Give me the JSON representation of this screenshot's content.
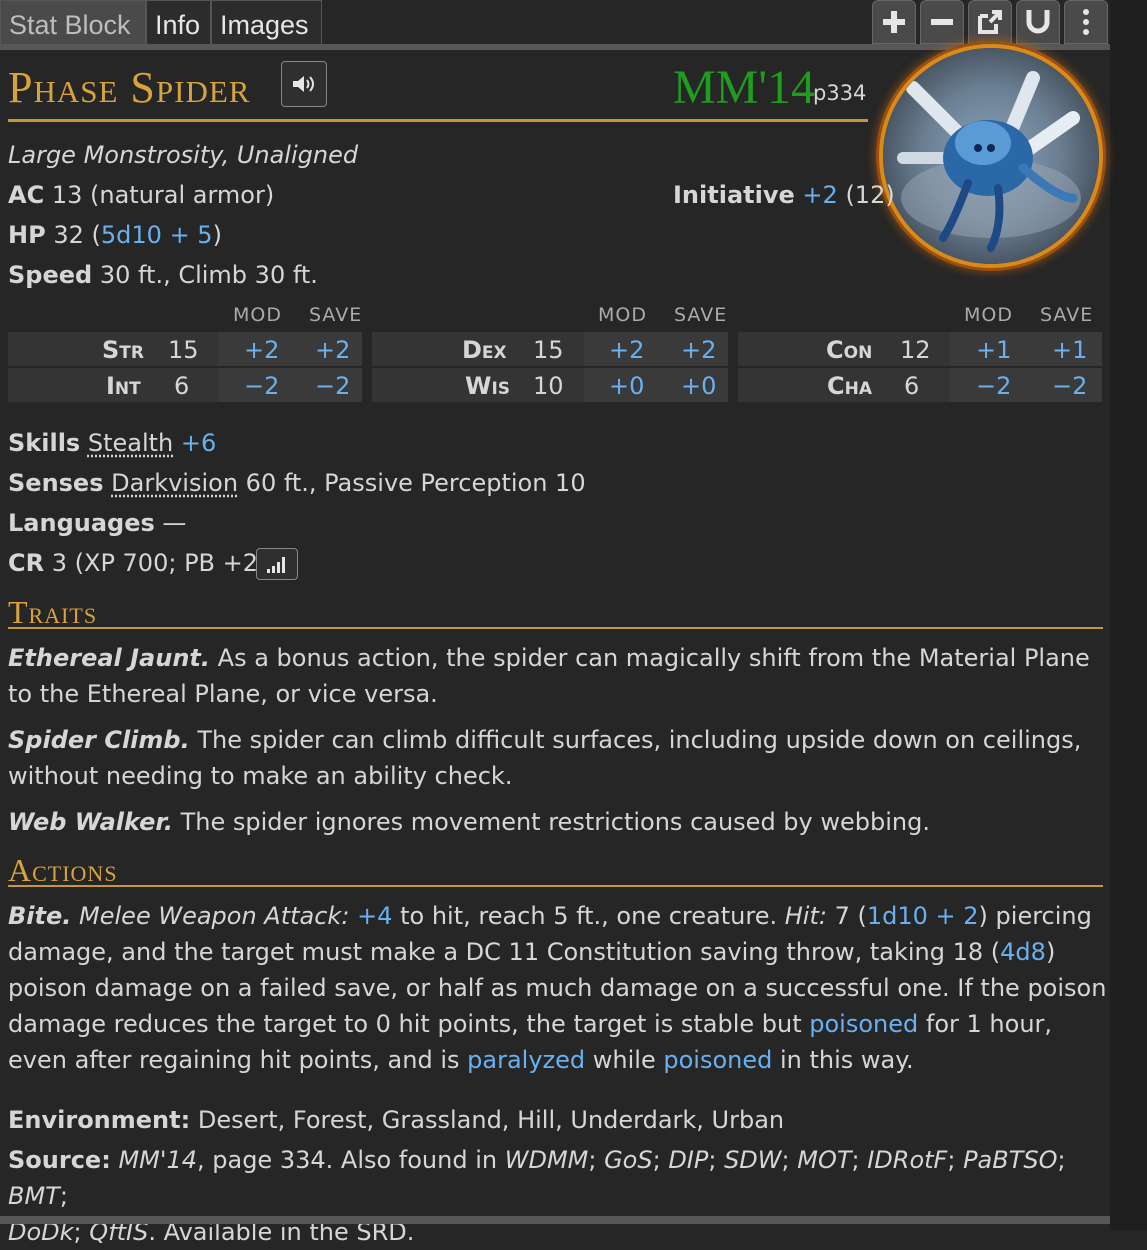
{
  "tabs": [
    "Stat Block",
    "Info",
    "Images"
  ],
  "toolbar": {
    "icons": [
      "plus-icon",
      "minus-icon",
      "popout-icon",
      "magnet-icon",
      "more-vertical-icon"
    ]
  },
  "monster": {
    "name": "Phase Spider",
    "source_abbr": "MM'14",
    "source_page": "p334",
    "type_line": "Large Monstrosity, Unaligned",
    "ac_label": "AC",
    "ac_value": "13 (natural armor)",
    "initiative_label": "Initiative",
    "initiative_mod": "+2",
    "initiative_score": "(12)",
    "hp_label": "HP",
    "hp_value": "32",
    "hp_dice": "5d10 + 5",
    "speed_label": "Speed",
    "speed_value": "30 ft., Climb 30 ft."
  },
  "abilities": {
    "mod_header": "MOD",
    "save_header": "SAVE",
    "groups": [
      [
        {
          "name": "Str",
          "score": "15",
          "mod": "+2",
          "save": "+2"
        },
        {
          "name": "Int",
          "score": "6",
          "mod": "−2",
          "save": "−2"
        }
      ],
      [
        {
          "name": "Dex",
          "score": "15",
          "mod": "+2",
          "save": "+2"
        },
        {
          "name": "Wis",
          "score": "10",
          "mod": "+0",
          "save": "+0"
        }
      ],
      [
        {
          "name": "Con",
          "score": "12",
          "mod": "+1",
          "save": "+1"
        },
        {
          "name": "Cha",
          "score": "6",
          "mod": "−2",
          "save": "−2"
        }
      ]
    ]
  },
  "skills": {
    "label": "Skills",
    "name": "Stealth",
    "value": "+6"
  },
  "senses": {
    "label": "Senses",
    "name": "Darkvision",
    "rest": "60 ft., Passive Perception 10"
  },
  "languages": {
    "label": "Languages",
    "value": "—"
  },
  "cr": {
    "label": "CR",
    "value": "3 (XP 700; PB +2)"
  },
  "traits": {
    "heading": "Traits",
    "items": [
      {
        "name": "Ethereal Jaunt.",
        "line1": "As a bonus action, the spider can magically shift from the Material Plane",
        "line2": "to the Ethereal Plane, or vice versa."
      },
      {
        "name": "Spider Climb.",
        "line1": "The spider can climb difficult surfaces, including upside down on ceilings,",
        "line2": "without needing to make an ability check."
      },
      {
        "name": "Web Walker.",
        "line1": "The spider ignores movement restrictions caused by webbing.",
        "line2": ""
      }
    ]
  },
  "actions": {
    "heading": "Actions",
    "bite": {
      "name": "Bite.",
      "attack_type": "Melee Weapon Attack:",
      "to_hit": "+4",
      "reach_text": "to hit, reach 5 ft., one creature.",
      "hit_label": "Hit:",
      "hit_avg": "7 (",
      "hit_dice": "1d10 + 2",
      "hit_after": ") piercing",
      "l2_a": "damage, and the target must make a DC 11 Constitution saving throw, taking 18 (",
      "l2_dice": "4d8",
      "l2_b": ")",
      "l3": "poison damage on a failed save, or half as much damage on a successful one. If the poison",
      "l4_a": "damage reduces the target to 0 hit points, the target is stable but",
      "l4_link": "poisoned",
      "l4_b": "for 1 hour,",
      "l5_a": "even after regaining hit points, and is",
      "l5_link1": "paralyzed",
      "l5_b": "while",
      "l5_link2": "poisoned",
      "l5_c": "in this way."
    }
  },
  "environment": {
    "label": "Environment:",
    "value": "Desert, Forest, Grassland, Hill, Underdark, Urban"
  },
  "source": {
    "label": "Source:",
    "book": "MM'14",
    "page_text": ", page 334. Also found in",
    "others": [
      "WDMM",
      "GoS",
      "DIP",
      "SDW",
      "MOT",
      "IDRotF",
      "PaBTSO",
      "BMT"
    ],
    "line2_books": [
      "DoDk",
      "QftIS"
    ],
    "srd": "Available in the SRD."
  }
}
